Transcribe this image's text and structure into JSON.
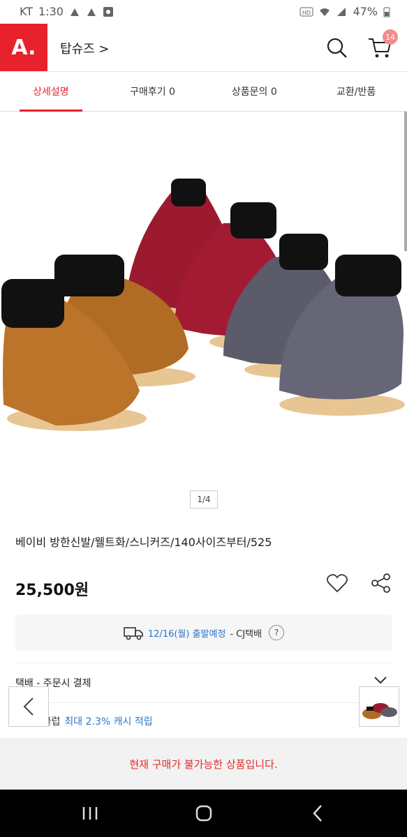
{
  "status_bar": {
    "carrier": "KT",
    "time": "1:30",
    "battery": "47%"
  },
  "header": {
    "logo": "A.",
    "shop_name": "탑슈즈 >",
    "cart_count": "14"
  },
  "tabs": [
    {
      "label": "상세설명",
      "active": true
    },
    {
      "label": "구매후기 0",
      "active": false
    },
    {
      "label": "상품문의 0",
      "active": false
    },
    {
      "label": "교환/반품",
      "active": false
    }
  ],
  "gallery": {
    "pager": "1/4"
  },
  "product": {
    "title": "베이비 방한신발/웰트화/스니커즈/140사이즈부터/525",
    "price": "25,500원"
  },
  "shipping": {
    "date": "12/16(월) 출발예정",
    "carrier": "- CJ택배",
    "help": "?"
  },
  "delivery_row": {
    "label": "택배 - 주문시 결제"
  },
  "cash_row": {
    "prefix": "스마일클럽",
    "highlight": "최대 2.3% 캐시 적립"
  },
  "soldout_message": "현재 구매가 불가능한 상품입니다.",
  "colors": {
    "brand": "#e8222c",
    "accent_blue": "#2a76c9"
  }
}
